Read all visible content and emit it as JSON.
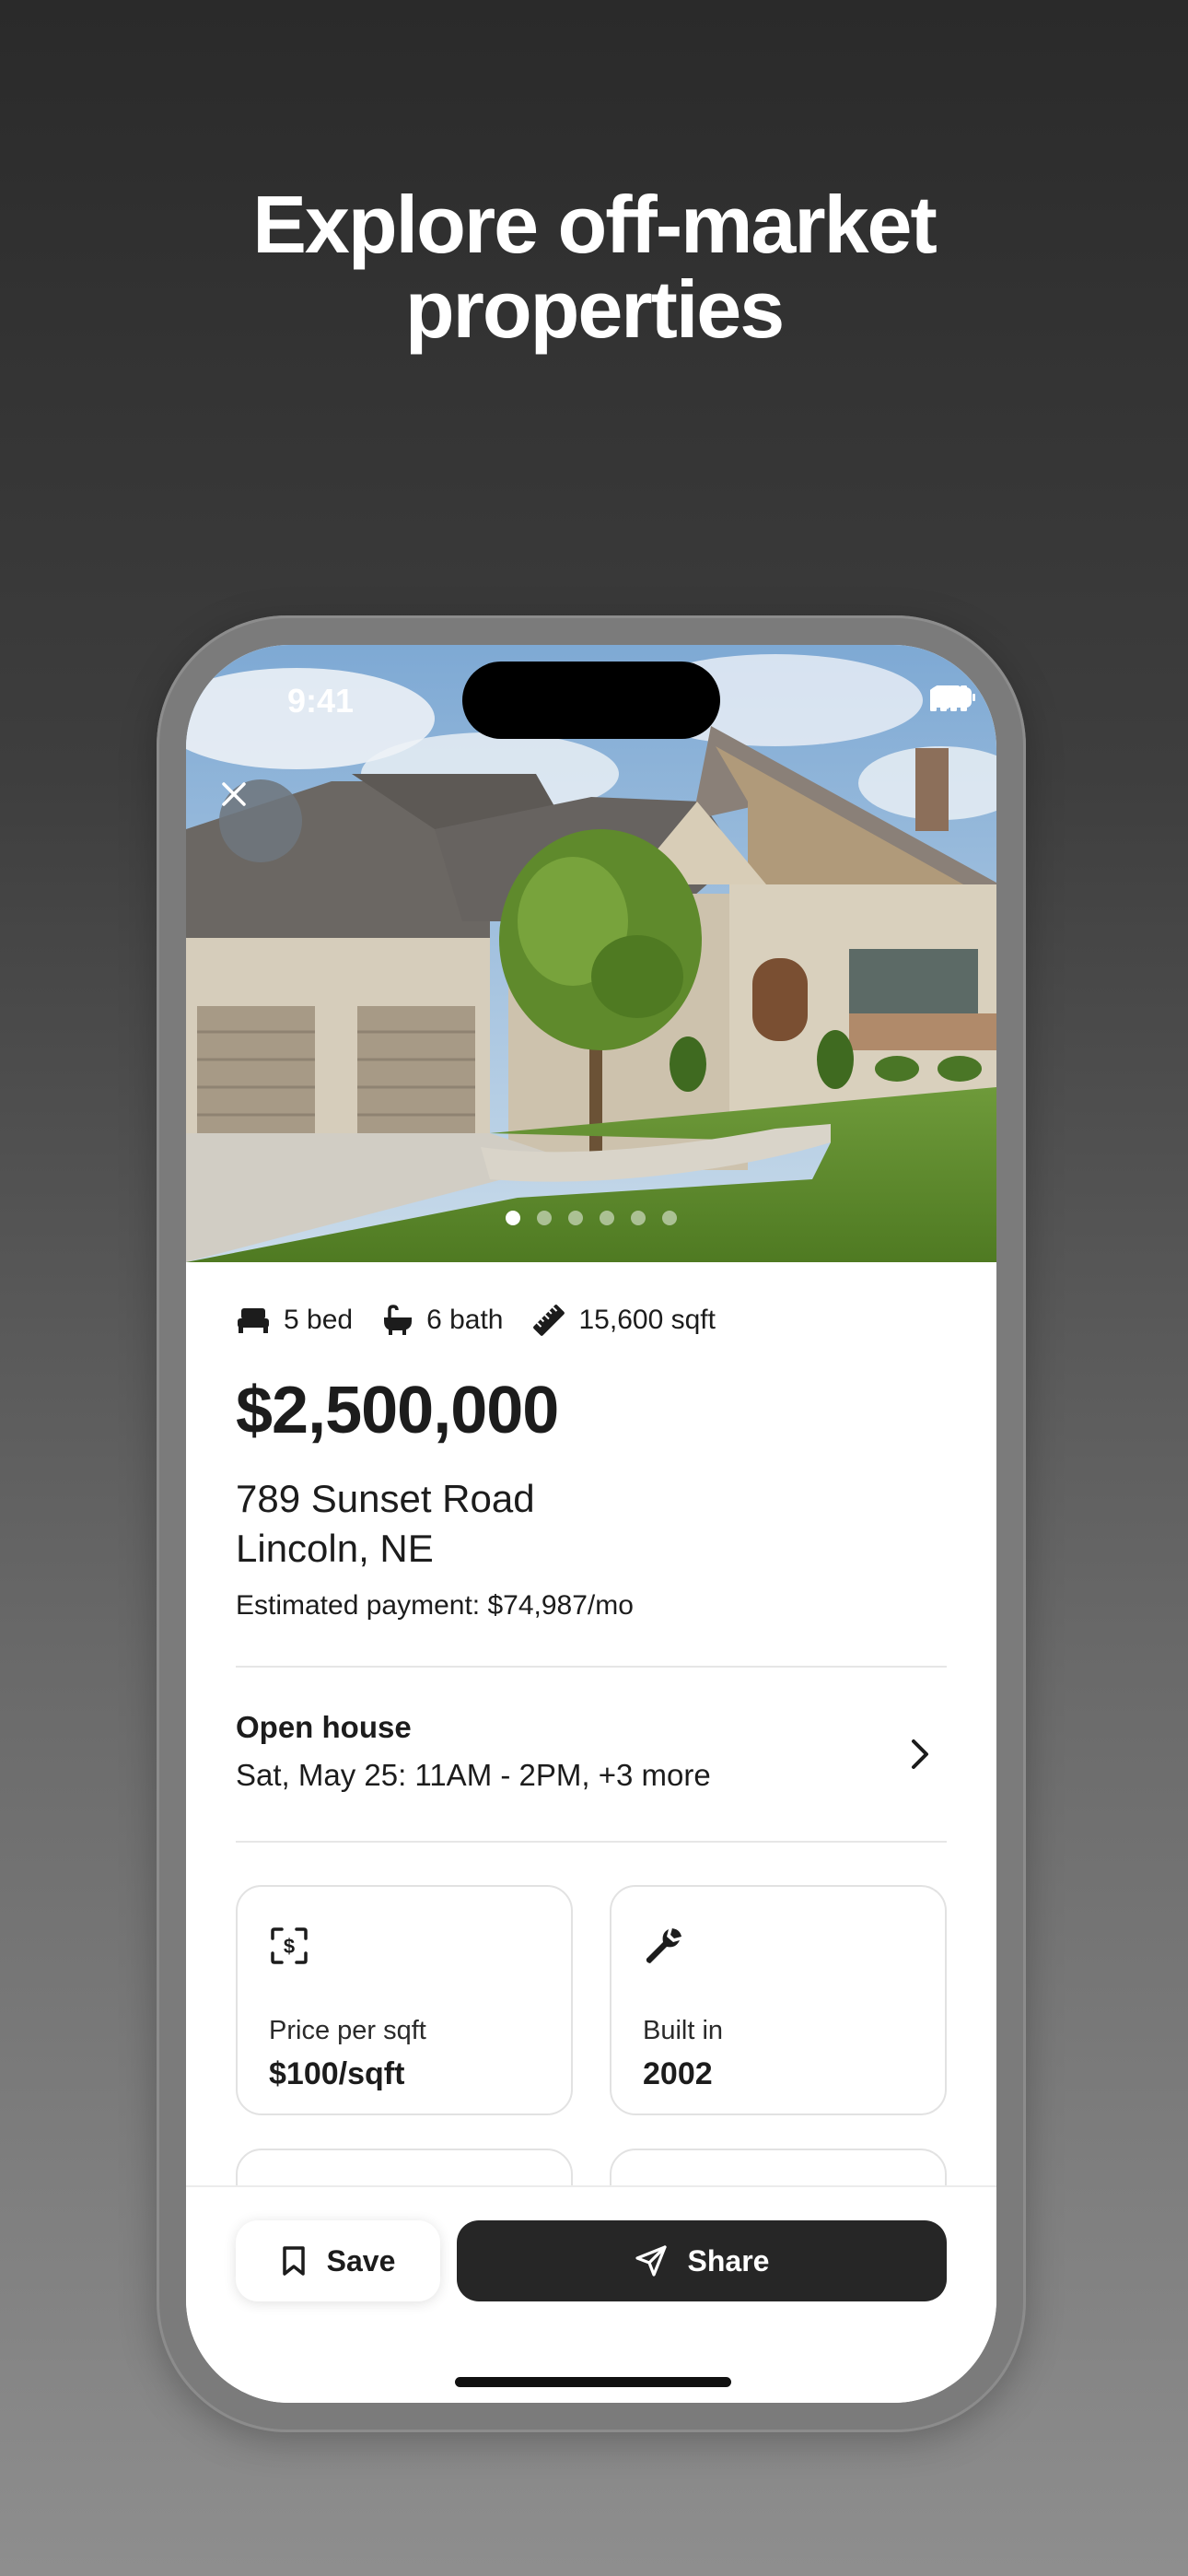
{
  "headline": {
    "line1": "Explore off-market",
    "line2": "properties"
  },
  "status_bar": {
    "time": "9:41"
  },
  "photo": {
    "total": 6,
    "current": 1
  },
  "listing": {
    "beds": "5 bed",
    "baths": "6 bath",
    "area": "15,600 sqft",
    "price": "$2,500,000",
    "address_line1": "789 Sunset Road",
    "address_line2": "Lincoln, NE",
    "estimated_payment": "Estimated payment: $74,987/mo"
  },
  "open_house": {
    "title": "Open house",
    "schedule": "Sat, May 25: 11AM - 2PM, +3 more"
  },
  "facts": [
    {
      "label": "Price per sqft",
      "value": "$100/sqft",
      "icon": "dollar-scan-icon"
    },
    {
      "label": "Built in",
      "value": "2002",
      "icon": "wrench-icon"
    }
  ],
  "actions": {
    "save_label": "Save",
    "share_label": "Share"
  },
  "colors": {
    "accent_dark": "#262626",
    "text": "#1c1c1c",
    "card_border": "#e2e2e2"
  }
}
